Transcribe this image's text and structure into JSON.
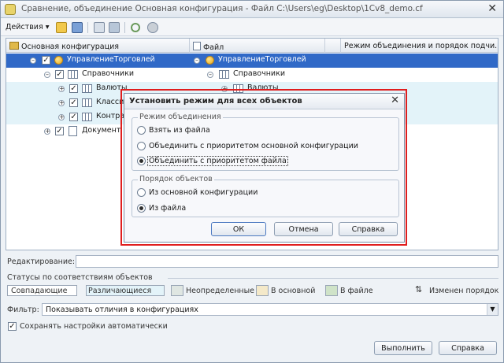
{
  "window": {
    "title": "Сравнение, объединение Основная конфигурация - Файл C:\\Users\\eg\\Desktop\\1Cv8_demo.cf",
    "close_glyph": "✕"
  },
  "toolbar": {
    "actions_label": "Действия ▾",
    "icons": [
      "open-icon",
      "save-icon",
      "filter-icon",
      "mark-icon",
      "refresh-icon",
      "settings-icon"
    ]
  },
  "grid": {
    "columns": [
      "Основная конфигурация",
      "Файл",
      "Режим объединения и порядок подчи..."
    ],
    "rows": [
      {
        "left": "УправлениеТорговлей",
        "right": "УправлениеТорговлей",
        "level": 0
      },
      {
        "left": "Справочники",
        "right": "Справочники",
        "level": 1
      },
      {
        "left": "Валюты",
        "right": "Валюты",
        "level": 2
      },
      {
        "left": "Класси",
        "right": "",
        "level": 2
      },
      {
        "left": "Контра",
        "right": "",
        "level": 2
      },
      {
        "left": "Документ",
        "right": "",
        "level": 1
      }
    ]
  },
  "dialog": {
    "title": "Установить режим для всех объектов",
    "close_glyph": "✕",
    "merge_group": {
      "label": "Режим объединения",
      "options": [
        "Взять из файла",
        "Объединить с приоритетом основной конфигурации",
        "Объединить с приоритетом файла"
      ],
      "selected": 2
    },
    "order_group": {
      "label": "Порядок объектов",
      "options": [
        "Из основной конфигурации",
        "Из файла"
      ],
      "selected": 1
    },
    "ok_label": "ОК",
    "cancel_label": "Отмена",
    "help_label": "Справка"
  },
  "editing": {
    "label": "Редактирование:",
    "value": ""
  },
  "statuses": {
    "title": "Статусы по соответствиям объектов",
    "items": [
      {
        "label": "Совпадающие",
        "color": "#ffffff"
      },
      {
        "label": "Различающиеся",
        "color": "#e3f3f9"
      },
      {
        "label": "Неопределенные",
        "color": "#dfe6e2"
      },
      {
        "label": "В основной",
        "color": "#f4e9c9"
      },
      {
        "label": "В файле",
        "color": "#cfe3c8"
      }
    ],
    "order_changed_label": "Изменен порядок"
  },
  "filter": {
    "label": "Фильтр:",
    "value": "Показывать отличия в конфигурациях"
  },
  "autosave": {
    "label": "Сохранять настройки автоматически",
    "checked": true
  },
  "footer": {
    "execute_label": "Выполнить",
    "help_label": "Справка"
  },
  "colors": {
    "selection": "#3069c7",
    "highlight_frame": "#e01e1e",
    "changed_row": "#e3f3f9"
  }
}
